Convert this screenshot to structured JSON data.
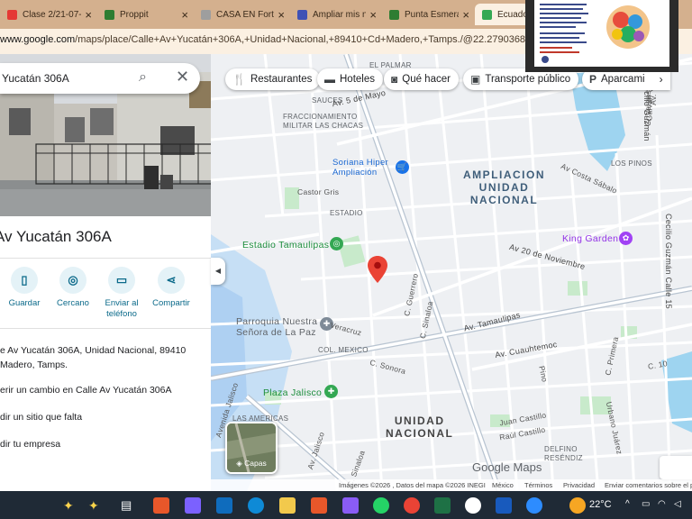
{
  "tabs": [
    {
      "title": "Clase 2/21-07-",
      "fav_color": "#e53935"
    },
    {
      "title": "Proppit",
      "fav_color": "#2e7d32"
    },
    {
      "title": "CASA EN Fortín",
      "fav_color": "#9e9e9e"
    },
    {
      "title": "Ampliar mis no",
      "fav_color": "#3f51b5"
    },
    {
      "title": "Punta Esmerald",
      "fav_color": "#2e7d32"
    },
    {
      "title": "Ecuador",
      "fav_color": "#34a853"
    }
  ],
  "address": {
    "domain": "www.google.com",
    "path": "/maps/place/Calle+Av+Yucatán+306A,+Unidad+Nacional,+89410+Cd+Madero,+Tamps./@22.2790368,-97.8510"
  },
  "search": {
    "query": "Yucatán 306A"
  },
  "place": {
    "title": "Av Yucatán 306A",
    "address_line1": "e Av Yucatán 306A, Unidad Nacional, 89410",
    "address_line2": "Madero, Tamps.",
    "suggest_edit": "erir un cambio en Calle Av Yucatán 306A",
    "add_place": "dir un sitio que falta",
    "add_business": "dir tu empresa"
  },
  "actions": [
    {
      "label": "Guardar",
      "icon": "bookmark-icon",
      "glyph": "▯"
    },
    {
      "label": "Cercano",
      "icon": "nearby-icon",
      "glyph": "◎"
    },
    {
      "label": "Enviar al teléfono",
      "icon": "phone-icon",
      "glyph": "▭"
    },
    {
      "label": "Compartir",
      "icon": "share-icon",
      "glyph": "⋖"
    }
  ],
  "chips": [
    {
      "label": "Restaurantes",
      "icon": "restaurant-icon",
      "glyph": "🍴"
    },
    {
      "label": "Hoteles",
      "icon": "hotel-icon",
      "glyph": "🛏"
    },
    {
      "label": "Qué hacer",
      "icon": "camera-icon",
      "glyph": "📷"
    },
    {
      "label": "Transporte público",
      "icon": "transit-icon",
      "glyph": "🚌"
    },
    {
      "label": "Aparcami",
      "icon": "parking-icon",
      "glyph": "P"
    }
  ],
  "map_labels": {
    "el_palmar": "EL PALMAR",
    "sauces": "SAUCES",
    "frac_militar": "FRACCIONAMIENTO\nMILITAR LAS CHACAS",
    "soriana": "Soriana Hiper\nAmpliación",
    "ampliacion": "AMPLIACION\nUNIDAD\nNACIONAL",
    "castor_gris": "Castor Gris",
    "estadio": "ESTADIO",
    "estadio_tamaulipas": "Estadio Tamaulipas",
    "king_garden": "King Garden",
    "los_pinos": "LOS PINOS",
    "parroquia": "Parroquia Nuestra\nSeñora de La Paz",
    "col_mexico": "COL. MEXICO",
    "plaza_jalisco": "Plaza Jalisco",
    "las_americas": "LAS AMERICAS",
    "unidad_nacional": "UNIDAD\nNACIONAL",
    "delfino": "DELFINO\nRESÉNDIZ",
    "av_5_mayo": "Av. 5 de Mayo",
    "av_costa_sabala": "Av Costa Sábalo",
    "av_20_nov": "Av 20 de Noviembre",
    "av_tamaulipas": "Av. Tamaulipas",
    "av_cuauhtemoc": "Av. Cuauhtemoc",
    "av_jalisco": "Av. Jalisco",
    "veracruz": "Veracruz",
    "c_sonora": "C. Sonora",
    "c_guerrero": "C. Guerrero",
    "c_sinaloa": "C. Sinaloa",
    "c_primera": "C. Primera",
    "c_10": "C. 10",
    "juan_castillo": "Juan Castillo",
    "raul_castillo": "Raúl Castillo",
    "urbano_juarez": "Urbano Juárez",
    "pino": "Pino",
    "cecilio_guzman": "Cecilio Guzmán",
    "cecilio_guzman_calle": "Cecilio Guzmán Calle 15",
    "av_yucatan_side": "Av. Yucatán",
    "c_vergas": "C. Vergas",
    "galvan": "Galván",
    "sinaloa_low": "C. Sinaloa",
    "avenida_jalisco": "Avenida Jalisco"
  },
  "layers_label": "Capas",
  "google_maps": "Google Maps",
  "footer": {
    "imagery": "Imágenes ©2026 , Datos del mapa ©2026 INEGI",
    "region": "México",
    "terms": "Términos",
    "privacy": "Privacidad",
    "feedback": "Enviar comentarios sobre el p"
  },
  "taskbar": {
    "temperature": "22°C"
  },
  "colors": {
    "tabstrip": "#d4b08e",
    "accent": "#0b6a8a",
    "pin": "#ea4335",
    "park": "#c8eacb",
    "water": "#9ed4f0"
  }
}
